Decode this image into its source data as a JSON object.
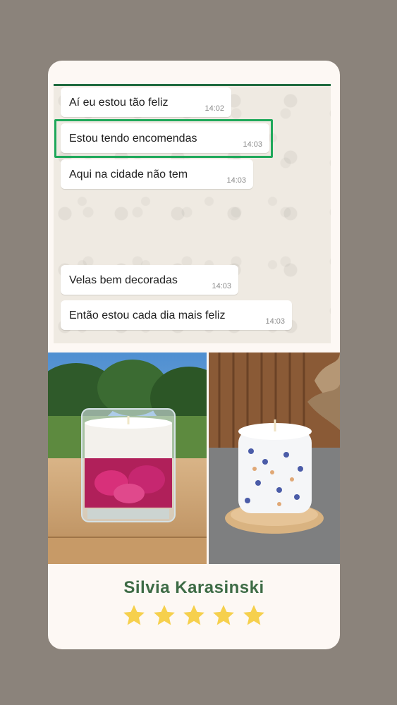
{
  "testimonial": {
    "messages": [
      {
        "text": "Aí eu estou tão feliz",
        "time": "14:02"
      },
      {
        "text": "Estou tendo encomendas",
        "time": "14:03",
        "highlighted": true
      },
      {
        "text": "Aqui na cidade não tem",
        "time": "14:03"
      },
      {
        "text": "Velas bem decoradas",
        "time": "14:03"
      },
      {
        "text": "Então estou cada dia mais feliz",
        "time": "14:03"
      }
    ],
    "author": "Silvia Karasinski",
    "rating": 5,
    "colors": {
      "background": "#8b837b",
      "card": "#fdf8f4",
      "name": "#3d6b45",
      "highlight": "#1fa85a",
      "star": "#f6d04d"
    },
    "icons": [
      "star-icon"
    ]
  }
}
